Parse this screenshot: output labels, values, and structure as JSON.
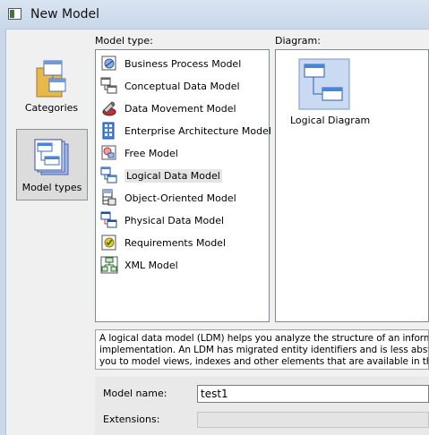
{
  "window": {
    "title": "New Model"
  },
  "left_pane": {
    "items": [
      {
        "label": "Categories",
        "icon": "categories-folder-icon",
        "selected": false
      },
      {
        "label": "Model types",
        "icon": "model-types-icon",
        "selected": true
      }
    ]
  },
  "model_type_label": "Model type:",
  "diagram_label": "Diagram:",
  "model_types": [
    {
      "label": "Business Process Model",
      "icon": "business-process-model-icon"
    },
    {
      "label": "Conceptual Data Model",
      "icon": "conceptual-data-model-icon"
    },
    {
      "label": "Data Movement Model",
      "icon": "data-movement-model-icon"
    },
    {
      "label": "Enterprise Architecture Model",
      "icon": "enterprise-architecture-model-icon"
    },
    {
      "label": "Free Model",
      "icon": "free-model-icon"
    },
    {
      "label": "Logical Data Model",
      "icon": "logical-data-model-icon",
      "selected": true
    },
    {
      "label": "Object-Oriented Model",
      "icon": "object-oriented-model-icon"
    },
    {
      "label": "Physical Data Model",
      "icon": "physical-data-model-icon"
    },
    {
      "label": "Requirements Model",
      "icon": "requirements-model-icon"
    },
    {
      "label": "XML Model",
      "icon": "xml-model-icon"
    }
  ],
  "diagram": {
    "label": "Logical Diagram",
    "icon": "logical-diagram-icon"
  },
  "description_lines": [
    "A logical data model (LDM) helps you analyze the structure of an information sy",
    "implementation. An LDM has migrated entity identifiers and is less abstract than",
    "you to model views, indexes and other elements that are available in the more c"
  ],
  "form": {
    "model_name_label": "Model name:",
    "model_name_value": "test1",
    "extensions_label": "Extensions:",
    "extensions_value": ""
  },
  "colors": {
    "titlebar": "#d9e4f1",
    "list_selection": "#e5e5e5",
    "panel_bg": "#f0f0f0"
  }
}
